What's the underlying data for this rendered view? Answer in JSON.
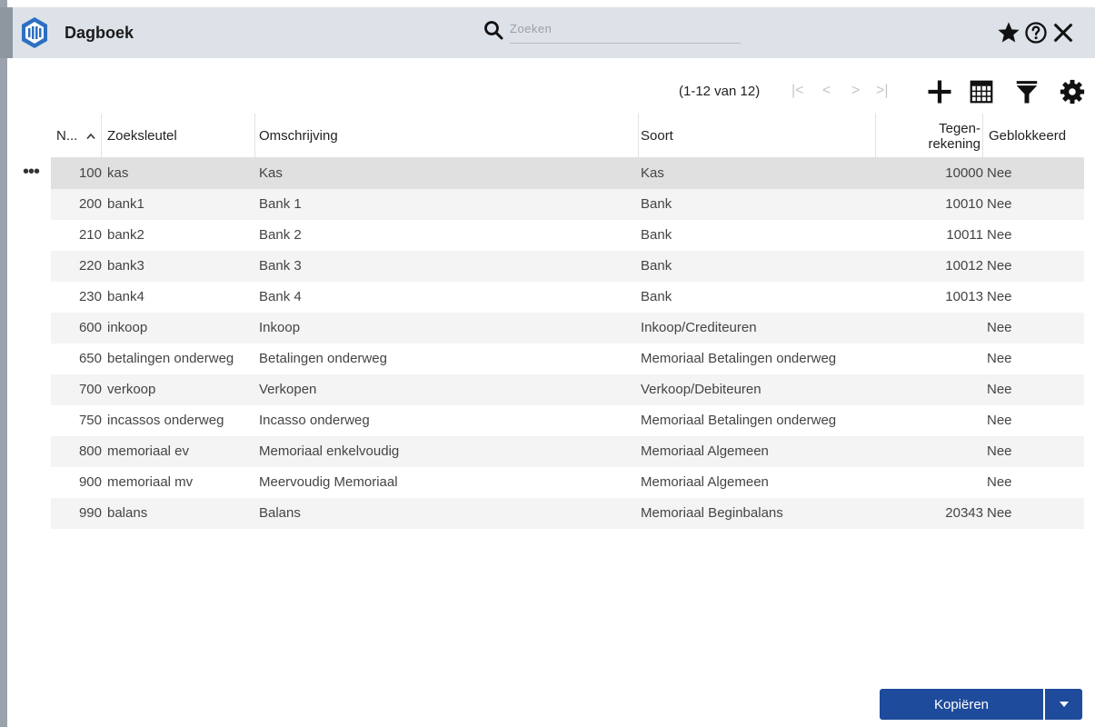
{
  "header": {
    "title": "Dagboek",
    "search_placeholder": "Zoeken",
    "icons": [
      "logo-icon",
      "search-icon",
      "star-icon",
      "help-icon",
      "close-icon"
    ]
  },
  "toolbar": {
    "range_text": "(1-12 van 12)",
    "pager_first": "|<",
    "pager_prev": "<",
    "pager_next": ">",
    "pager_last": ">|",
    "icons": [
      "plus-icon",
      "calendar-icon",
      "filter-icon",
      "settings-icon"
    ]
  },
  "table": {
    "columns": {
      "nummer": "N...",
      "zoeksleutel": "Zoeksleutel",
      "omschrijving": "Omschrijving",
      "soort": "Soort",
      "tegenrekening_1": "Tegen-",
      "tegenrekening_2": "rekening",
      "geblokkeerd": "Geblokkeerd"
    },
    "row_menu_label": "•••",
    "rows": [
      {
        "nummer": "100",
        "zoeksleutel": "kas",
        "omschrijving": "Kas",
        "soort": "Kas",
        "tegenrekening": "10000",
        "geblokkeerd": "Nee"
      },
      {
        "nummer": "200",
        "zoeksleutel": "bank1",
        "omschrijving": "Bank 1",
        "soort": "Bank",
        "tegenrekening": "10010",
        "geblokkeerd": "Nee"
      },
      {
        "nummer": "210",
        "zoeksleutel": "bank2",
        "omschrijving": "Bank 2",
        "soort": "Bank",
        "tegenrekening": "10011",
        "geblokkeerd": "Nee"
      },
      {
        "nummer": "220",
        "zoeksleutel": "bank3",
        "omschrijving": "Bank 3",
        "soort": "Bank",
        "tegenrekening": "10012",
        "geblokkeerd": "Nee"
      },
      {
        "nummer": "230",
        "zoeksleutel": "bank4",
        "omschrijving": "Bank 4",
        "soort": "Bank",
        "tegenrekening": "10013",
        "geblokkeerd": "Nee"
      },
      {
        "nummer": "600",
        "zoeksleutel": "inkoop",
        "omschrijving": "Inkoop",
        "soort": "Inkoop/Crediteuren",
        "tegenrekening": "",
        "geblokkeerd": "Nee"
      },
      {
        "nummer": "650",
        "zoeksleutel": "betalingen onderweg",
        "omschrijving": "Betalingen onderweg",
        "soort": "Memoriaal Betalingen onderweg",
        "tegenrekening": "",
        "geblokkeerd": "Nee"
      },
      {
        "nummer": "700",
        "zoeksleutel": "verkoop",
        "omschrijving": "Verkopen",
        "soort": "Verkoop/Debiteuren",
        "tegenrekening": "",
        "geblokkeerd": "Nee"
      },
      {
        "nummer": "750",
        "zoeksleutel": "incassos onderweg",
        "omschrijving": "Incasso onderweg",
        "soort": "Memoriaal Betalingen onderweg",
        "tegenrekening": "",
        "geblokkeerd": "Nee"
      },
      {
        "nummer": "800",
        "zoeksleutel": "memoriaal ev",
        "omschrijving": "Memoriaal enkelvoudig",
        "soort": "Memoriaal Algemeen",
        "tegenrekening": "",
        "geblokkeerd": "Nee"
      },
      {
        "nummer": "900",
        "zoeksleutel": "memoriaal mv",
        "omschrijving": "Meervoudig Memoriaal",
        "soort": "Memoriaal Algemeen",
        "tegenrekening": "",
        "geblokkeerd": "Nee"
      },
      {
        "nummer": "990",
        "zoeksleutel": "balans",
        "omschrijving": "Balans",
        "soort": "Memoriaal Beginbalans",
        "tegenrekening": "20343",
        "geblokkeerd": "Nee"
      }
    ]
  },
  "footer": {
    "copy_label": "Kopiëren"
  },
  "colors": {
    "header_bg": "#dce2e8",
    "accent_button": "#1e4b9b",
    "logo_blue": "#2d6fc2"
  }
}
